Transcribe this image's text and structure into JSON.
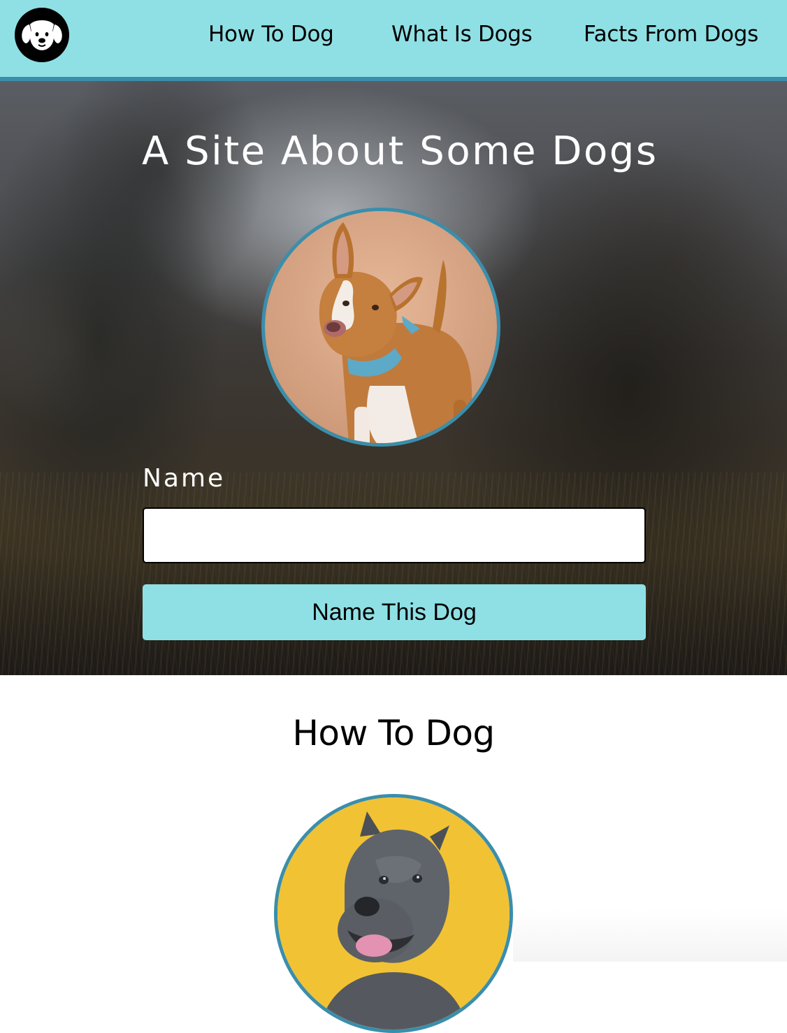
{
  "nav": {
    "logo_icon": "dog-face-icon",
    "links": [
      "How To Dog",
      "What Is Dogs",
      "Facts From Dogs"
    ],
    "background": "#8fe0e4",
    "border_color": "#3a8eab"
  },
  "hero": {
    "title": "A Site About Some Dogs",
    "avatar_icon": "dog-photo-tan-pitbull",
    "form": {
      "label": "Name",
      "input_value": "",
      "input_placeholder": "",
      "button_label": "Name This Dog"
    }
  },
  "section": {
    "title": "How To Dog",
    "avatar_icon": "dog-photo-grey-pitbull"
  },
  "colors": {
    "accent": "#8fe0e4",
    "ring": "#3a8eab"
  }
}
